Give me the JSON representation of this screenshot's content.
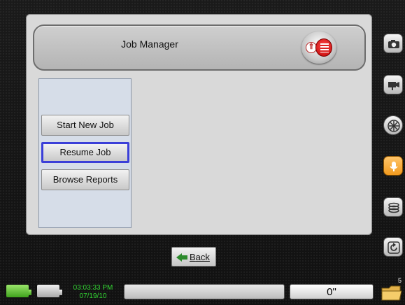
{
  "header": {
    "title": "Job Manager"
  },
  "menu": {
    "items": [
      {
        "label": "Start New Job"
      },
      {
        "label": "Resume Job"
      },
      {
        "label": "Browse Reports"
      }
    ]
  },
  "back_button": {
    "label": "Back"
  },
  "status": {
    "time": "03:03:33 PM",
    "date": "07/19/10",
    "distance": "0\"",
    "folder_count": "5"
  },
  "colors": {
    "selection": "#3b3fd8",
    "clock_text": "#32d332",
    "active_tool": "#f19a1e"
  },
  "icons": [
    "camera-icon",
    "video-camera-icon",
    "sonde-icon",
    "microphone-icon",
    "reel-icon",
    "rotate-icon",
    "folder-icon"
  ]
}
